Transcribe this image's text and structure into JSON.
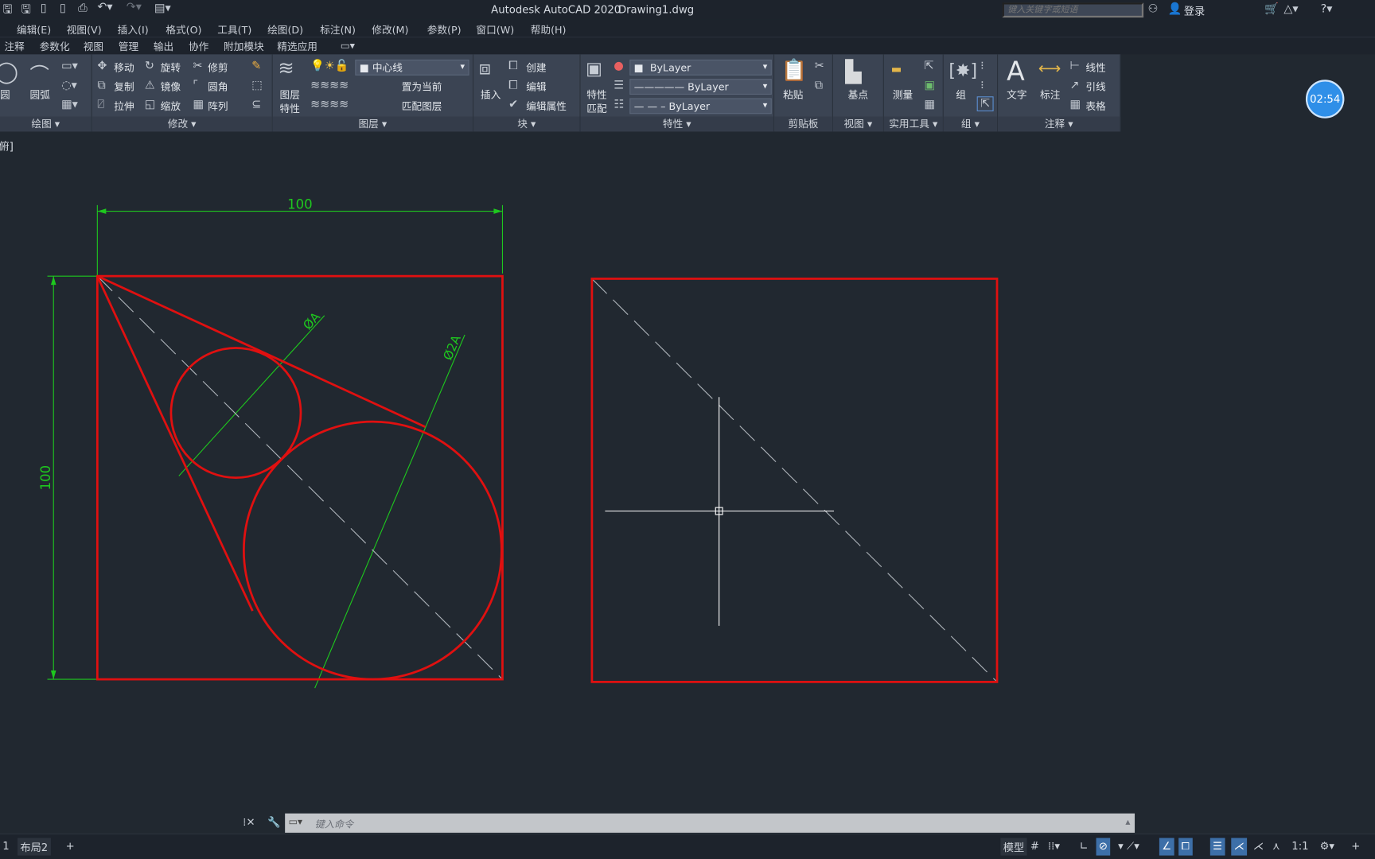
{
  "title": {
    "app": "Autodesk AutoCAD 2020",
    "file": "Drawing1.dwg"
  },
  "search": {
    "placeholder": "键入关键字或短语"
  },
  "login": "登录",
  "menu": [
    "编辑(E)",
    "视图(V)",
    "插入(I)",
    "格式(O)",
    "工具(T)",
    "绘图(D)",
    "标注(N)",
    "修改(M)",
    "参数(P)",
    "窗口(W)",
    "帮助(H)"
  ],
  "tabs": [
    "注释",
    "参数化",
    "视图",
    "管理",
    "输出",
    "协作",
    "附加模块",
    "精选应用"
  ],
  "ribbon": {
    "draw": {
      "circle": "圆",
      "arc": "圆弧",
      "label": "绘图"
    },
    "modify": {
      "move": "移动",
      "rotate": "旋转",
      "trim": "修剪",
      "copy": "复制",
      "mirror": "镜像",
      "fillet": "圆角",
      "stretch": "拉伸",
      "scale": "缩放",
      "array": "阵列",
      "label": "修改"
    },
    "layer": {
      "props1": "图层",
      "props2": "特性",
      "current_layer": "中心线",
      "set_current": "置为当前",
      "match": "匹配图层",
      "label": "图层"
    },
    "block": {
      "insert": "插入",
      "create": "创建",
      "edit": "编辑",
      "edit_attr": "编辑属性",
      "label": "块"
    },
    "properties": {
      "match1": "特性",
      "match2": "匹配",
      "color": "ByLayer",
      "linetype": "ByLayer",
      "lineweight": "ByLayer",
      "label": "特性"
    },
    "clipboard": {
      "paste": "粘贴",
      "label": "剪贴板"
    },
    "view": {
      "base": "基点",
      "label": "视图"
    },
    "utilities": {
      "measure": "测量",
      "label": "实用工具"
    },
    "groups": {
      "group": "组",
      "label": "组"
    },
    "annotation": {
      "text": "文字",
      "dim": "标注",
      "linear": "线性",
      "leader": "引线",
      "table": "表格",
      "label": "注释"
    }
  },
  "timer": "02:54",
  "viewport_label": "[俯]",
  "drawing": {
    "dim_horizontal": "100",
    "dim_vertical": "100",
    "dia_small": "ØA",
    "dia_large": "Ø2A",
    "colors": {
      "geometry": "#e01010",
      "dimension": "#1ec81e",
      "center": "#aeb4ba",
      "crosshair": "#ffffff"
    }
  },
  "command": {
    "placeholder": "键入命令"
  },
  "layout_tabs": [
    "1",
    "布局2",
    "+"
  ],
  "status": {
    "model": "模型",
    "scale": "1:1"
  }
}
